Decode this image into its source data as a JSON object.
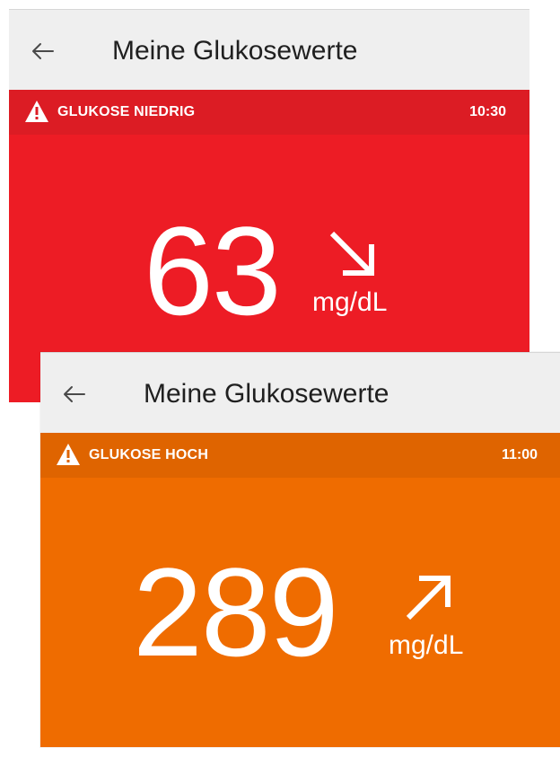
{
  "screens": [
    {
      "header": {
        "title": "Meine Glukosewerte",
        "back_icon": "back-arrow-icon"
      },
      "alert": {
        "label": "GLUKOSE NIEDRIG",
        "time": "10:30",
        "icon": "warning-icon",
        "banner_color": "#dc1c24"
      },
      "reading": {
        "value": "63",
        "unit": "mg/dL",
        "trend_icon": "trend-down-right-icon",
        "background_color": "#ed1c25"
      }
    },
    {
      "header": {
        "title": "Meine Glukosewerte",
        "back_icon": "back-arrow-icon"
      },
      "alert": {
        "label": "GLUKOSE HOCH",
        "time": "11:00",
        "icon": "warning-icon",
        "banner_color": "#df6400"
      },
      "reading": {
        "value": "289",
        "unit": "mg/dL",
        "trend_icon": "trend-up-right-icon",
        "background_color": "#ef6c00"
      }
    }
  ]
}
